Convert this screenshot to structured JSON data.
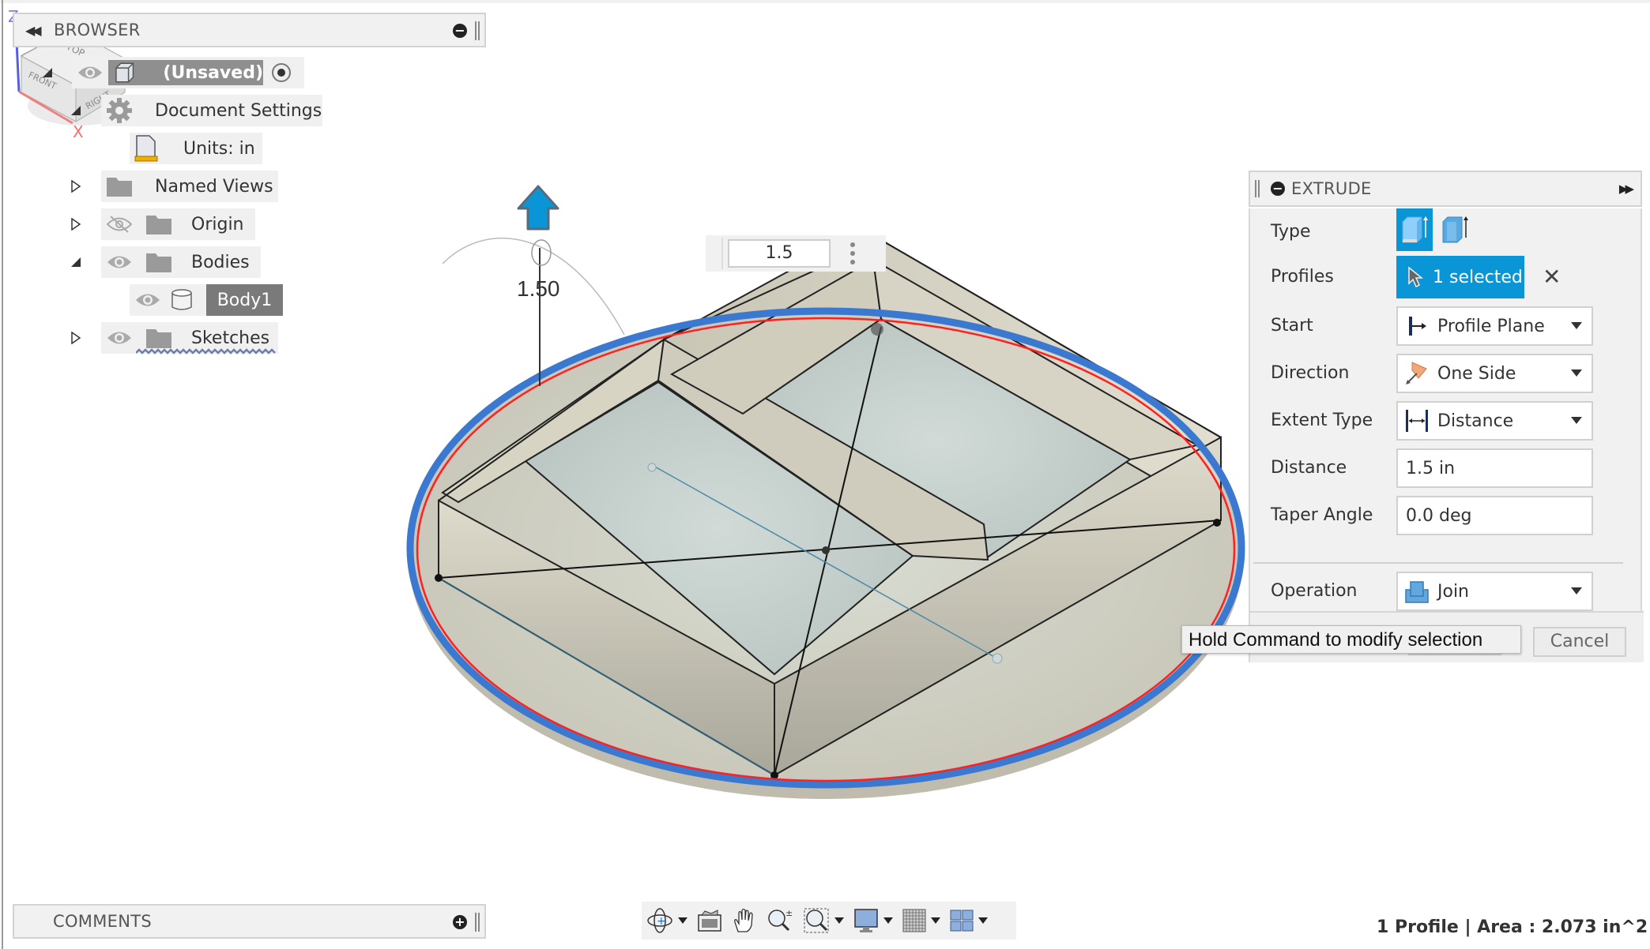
{
  "browser": {
    "title": "BROWSER",
    "tree": [
      {
        "label": "(Unsaved)",
        "expanded": true,
        "icon": "component-icon",
        "visible": true,
        "active": true
      },
      {
        "label": "Document Settings",
        "expanded": true,
        "icon": "gear-icon"
      },
      {
        "label": "Units: in",
        "icon": "units-document-icon"
      },
      {
        "label": "Named Views",
        "expanded": false,
        "icon": "folder-icon"
      },
      {
        "label": "Origin",
        "expanded": false,
        "icon": "folder-icon",
        "visible": false
      },
      {
        "label": "Bodies",
        "expanded": true,
        "icon": "folder-icon",
        "visible": true
      },
      {
        "label": "Body1",
        "icon": "body-icon",
        "visible": true,
        "selected": true
      },
      {
        "label": "Sketches",
        "expanded": false,
        "icon": "folder-icon",
        "visible": true
      }
    ]
  },
  "comments": {
    "title": "COMMENTS"
  },
  "viewport": {
    "dimension_input": "1.5",
    "dimension_label": "1.50",
    "viewcube": {
      "top": "TOP",
      "front": "FRONT",
      "right": "RIGHT",
      "axis_z": "Z",
      "axis_x": "X"
    }
  },
  "extrude": {
    "title": "EXTRUDE",
    "rows": {
      "type": {
        "label": "Type",
        "options": [
          "solid-extrude-icon",
          "thin-extrude-icon"
        ],
        "selected": 0
      },
      "profiles": {
        "label": "Profiles",
        "value": "1 selected"
      },
      "start": {
        "label": "Start",
        "value": "Profile Plane"
      },
      "direction": {
        "label": "Direction",
        "value": "One Side"
      },
      "extent_type": {
        "label": "Extent Type",
        "value": "Distance"
      },
      "distance": {
        "label": "Distance",
        "value": "1.5 in"
      },
      "taper_angle": {
        "label": "Taper Angle",
        "value": "0.0 deg"
      },
      "operation": {
        "label": "Operation",
        "value": "Join"
      }
    },
    "cancel_label": "Cancel"
  },
  "tooltip": "Hold Command to modify selection",
  "navbar": {
    "items": [
      "orbit",
      "look-at",
      "pan",
      "zoom",
      "fit",
      "display-settings",
      "grid-snaps",
      "viewports"
    ]
  },
  "status": "1 Profile | Area : 2.073 in^2",
  "colors": {
    "accent": "#0a96d6",
    "selection_blue": "#3b78d0",
    "profile_red": "#ff2020"
  }
}
